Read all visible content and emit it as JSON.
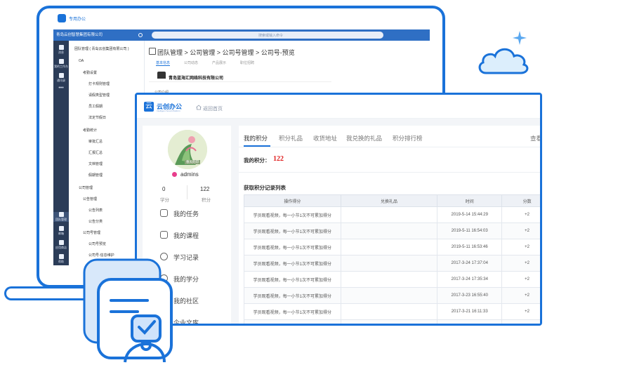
{
  "back_app": {
    "brand": "专用办公",
    "company": "青岛云创智慧集团有限公司",
    "search_placeholder": "搜索或输入命令",
    "rail": [
      "消息",
      "我的工作台",
      "通讯录",
      "团队管理",
      "邮箱",
      "应用商店",
      "帮助"
    ],
    "tree": [
      "团队管理 ( 青岛云创集团有限公司 )",
      "OA",
      "考勤设置",
      "打卡规则管理",
      "请假类型管理",
      "员工假期",
      "法定节假日",
      "考勤统计",
      "审批汇总",
      "汇报汇总",
      "文档管理",
      "假期管理",
      "公司管理",
      "公告管理",
      "公告列表",
      "公告分类",
      "公司号管理",
      "公司号预览",
      "公司号-信息维护"
    ],
    "breadcrumb": "团队管理  >  公司管理  >  公司号管理  >  公司号-预览",
    "subtabs": [
      "基本信息",
      "公司动态",
      "产品展示",
      "职位招聘"
    ],
    "company_name": "青岛蓝海汇网络科技有限公司",
    "section": "公司介绍"
  },
  "front_app": {
    "logo_title": "云创办公",
    "logo_subtitle": "Intelligent Smart Platform",
    "home_link": "返回首页",
    "avatar_tag": "春天的印",
    "username": "admins",
    "stats": [
      {
        "value": "0",
        "label": "学分"
      },
      {
        "value": "122",
        "label": "积分"
      }
    ],
    "menu": [
      "我的任务",
      "我的课程",
      "学习记录",
      "我的学分",
      "我的社区",
      "企业文库"
    ],
    "tabs": [
      "我的积分",
      "积分礼品",
      "收货地址",
      "我兑换的礼品",
      "积分排行榜"
    ],
    "tab_more": "查看",
    "points_label": "我的积分：",
    "points_value": "122",
    "list_title": "获取积分记录列表",
    "table": {
      "headers": [
        "操作得分",
        "兑换礼品",
        "时间",
        "分数"
      ],
      "rows": [
        [
          "学员观看视频，每一小节1次不可累加得分",
          "",
          "2019-5-14 15:44:29",
          "+2"
        ],
        [
          "学员观看视频，每一小节1次不可累加得分",
          "",
          "2019-5-11 16:54:03",
          "+2"
        ],
        [
          "学员观看视频，每一小节1次不可累加得分",
          "",
          "2019-5-11 16:53:46",
          "+2"
        ],
        [
          "学员观看视频，每一小节1次不可累加得分",
          "",
          "2017-3-24 17:37:04",
          "+2"
        ],
        [
          "学员观看视频，每一小节1次不可累加得分",
          "",
          "2017-3-24 17:35:34",
          "+2"
        ],
        [
          "学员观看视频，每一小节1次不可累加得分",
          "",
          "2017-3-23 16:55:40",
          "+2"
        ],
        [
          "学员观看视频，每一小节1次不可累加得分",
          "",
          "2017-3-21 16:11:33",
          "+2"
        ],
        [
          "",
          "",
          "",
          ""
        ]
      ]
    }
  },
  "colors": {
    "brand": "#1a72d9",
    "topbar": "#2f6fc4",
    "rail": "#2b3c58",
    "points": "#e02020"
  }
}
